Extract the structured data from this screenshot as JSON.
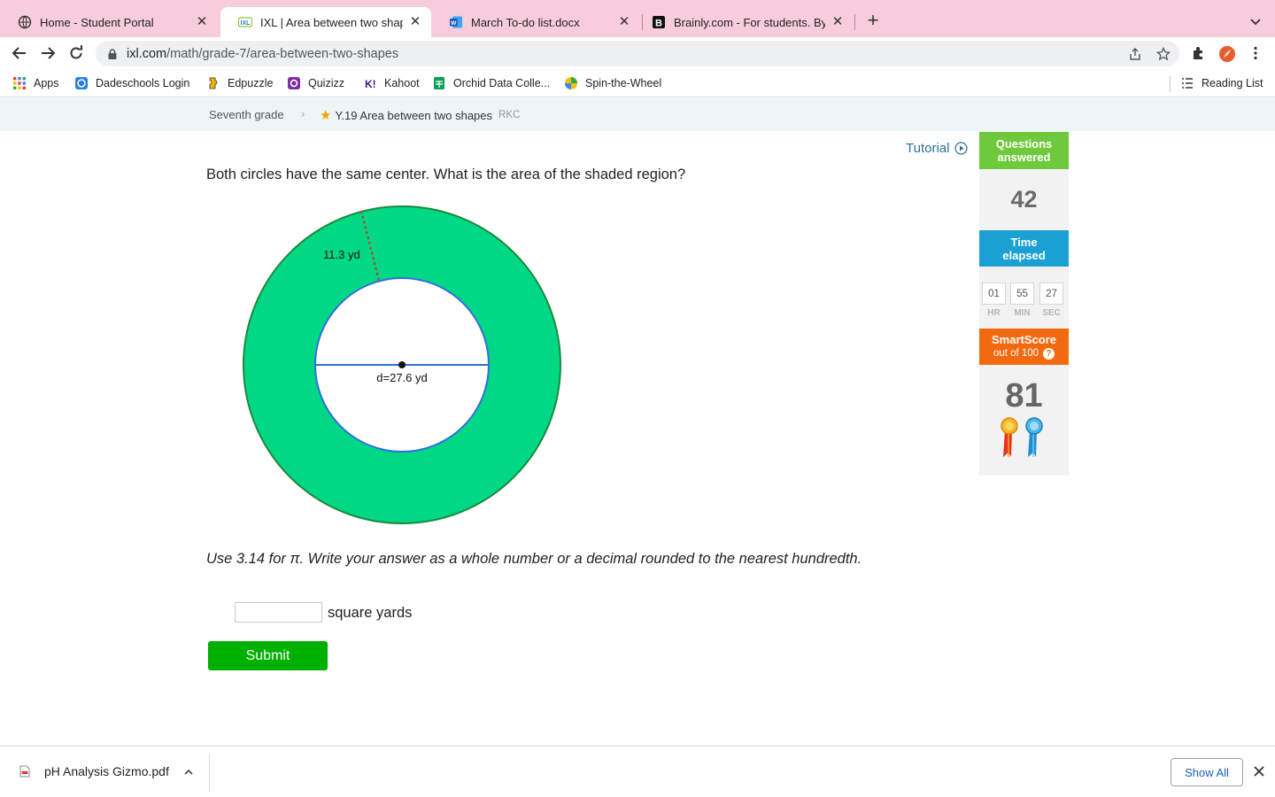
{
  "browser": {
    "tabs": [
      {
        "label": "Home - Student Portal",
        "icon": "globe-icon",
        "active": false
      },
      {
        "label": "IXL | Area between two shapes",
        "icon": "ixl-icon",
        "active": true
      },
      {
        "label": "March To-do list.docx",
        "icon": "word-icon",
        "active": false
      },
      {
        "label": "Brainly.com - For students. By",
        "icon": "brainly-icon",
        "active": false
      }
    ],
    "close_glyph": "✕",
    "new_tab_glyph": "+",
    "url_host": "ixl.com",
    "url_path": "/math/grade-7/area-between-two-shapes",
    "bookmarks": [
      {
        "label": "Apps",
        "icon": "apps-grid-icon"
      },
      {
        "label": "Dadeschools Login",
        "icon": "dadeschools-icon"
      },
      {
        "label": "Edpuzzle",
        "icon": "edpuzzle-icon"
      },
      {
        "label": "Quizizz",
        "icon": "quizizz-icon"
      },
      {
        "label": "Kahoot",
        "icon": "kahoot-icon"
      },
      {
        "label": "Orchid Data Colle...",
        "icon": "sheets-icon"
      },
      {
        "label": "Spin-the-Wheel",
        "icon": "wheel-icon"
      }
    ],
    "reading_list": "Reading List"
  },
  "breadcrumb": {
    "grade": "Seventh grade",
    "separator": "›",
    "skill": "Y.19 Area between two shapes",
    "code": "RKC"
  },
  "tutorial_label": "Tutorial",
  "question": "Both circles have the same center. What is the area of the shaded region?",
  "figure": {
    "ring_label": "11.3 yd",
    "diameter_label": "d=27.6 yd",
    "colors": {
      "shaded": "#00d885",
      "outer_stroke": "#1a8a3c",
      "inner_stroke": "#2f6fe0",
      "dashed_line": "#c0392b"
    }
  },
  "instructions": "Use 3.14 for π. Write your answer as a whole number or a decimal rounded to the nearest hundredth.",
  "answer": {
    "value": "",
    "unit": "square yards"
  },
  "submit_label": "Submit",
  "stats": {
    "questions_label_1": "Questions",
    "questions_label_2": "answered",
    "questions_answered": "42",
    "time_label_1": "Time",
    "time_label_2": "elapsed",
    "time": {
      "hr": "01",
      "min": "55",
      "sec": "27"
    },
    "time_units": {
      "hr": "HR",
      "min": "MIN",
      "sec": "SEC"
    },
    "smartscore_label": "SmartScore",
    "smartscore_sub": "out of 100",
    "help_glyph": "?",
    "smartscore": "81",
    "colors": {
      "questions": "#6fc93c",
      "time": "#1ba0d4",
      "smartscore": "#f26a10"
    }
  },
  "downloads": {
    "file": "pH Analysis Gizmo.pdf",
    "show_all": "Show All"
  }
}
